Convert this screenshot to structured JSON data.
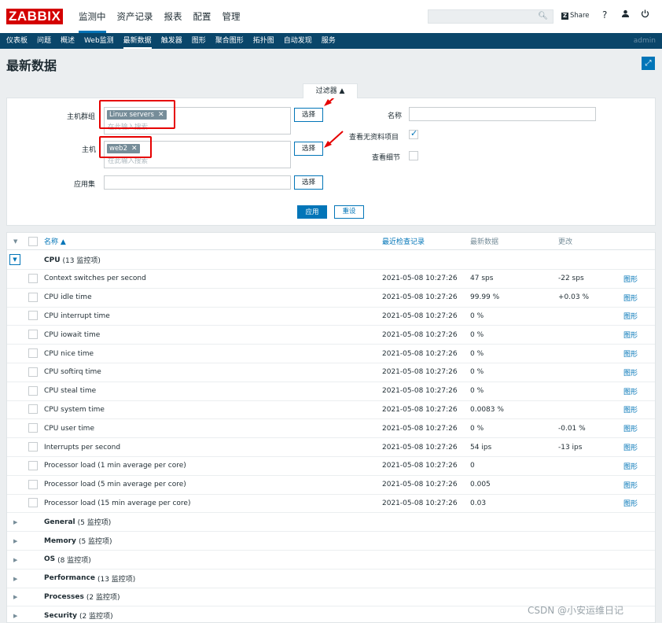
{
  "brand": {
    "logo": "ZABBIX"
  },
  "top_menu": [
    {
      "label": "监测中",
      "active": true
    },
    {
      "label": "资产记录",
      "active": false
    },
    {
      "label": "报表",
      "active": false
    },
    {
      "label": "配置",
      "active": false
    },
    {
      "label": "管理",
      "active": false
    }
  ],
  "top_right": {
    "share_label": "Share",
    "help_label": "?"
  },
  "sub_nav": [
    {
      "label": "仪表板",
      "active": false
    },
    {
      "label": "问题",
      "active": false
    },
    {
      "label": "概述",
      "active": false
    },
    {
      "label": "Web监测",
      "active": false
    },
    {
      "label": "最新数据",
      "active": true
    },
    {
      "label": "触发器",
      "active": false
    },
    {
      "label": "图形",
      "active": false
    },
    {
      "label": "聚合图形",
      "active": false
    },
    {
      "label": "拓扑图",
      "active": false
    },
    {
      "label": "自动发现",
      "active": false
    },
    {
      "label": "服务",
      "active": false
    }
  ],
  "user": "admin",
  "page_title": "最新数据",
  "filter": {
    "tab_label": "过滤器 ▲",
    "host_group_label": "主机群组",
    "host_group_tag": "Linux servers",
    "host_group_placeholder": "在此输入搜索",
    "host_label": "主机",
    "host_tag": "web2",
    "host_placeholder": "在此输入搜索",
    "app_label": "应用集",
    "app_value": "",
    "select_label": "选择",
    "name_label": "名称",
    "name_value": "",
    "show_no_data_label": "查看无资料项目",
    "show_no_data_checked": true,
    "show_details_label": "查看细节",
    "show_details_checked": false,
    "apply_label": "应用",
    "reset_label": "重设"
  },
  "table": {
    "headers": {
      "name": "名称 ▲",
      "last_check": "最近检查记录",
      "last_value": "最新数据",
      "change": "更改"
    },
    "expanded_group": {
      "name": "CPU",
      "count": "(13 监控项)"
    },
    "graph_label": "图形",
    "items": [
      {
        "name": "Context switches per second",
        "last_check": "2021-05-08 10:27:26",
        "last_value": "47 sps",
        "change": "-22 sps"
      },
      {
        "name": "CPU idle time",
        "last_check": "2021-05-08 10:27:26",
        "last_value": "99.99 %",
        "change": "+0.03 %"
      },
      {
        "name": "CPU interrupt time",
        "last_check": "2021-05-08 10:27:26",
        "last_value": "0 %",
        "change": ""
      },
      {
        "name": "CPU iowait time",
        "last_check": "2021-05-08 10:27:26",
        "last_value": "0 %",
        "change": ""
      },
      {
        "name": "CPU nice time",
        "last_check": "2021-05-08 10:27:26",
        "last_value": "0 %",
        "change": ""
      },
      {
        "name": "CPU softirq time",
        "last_check": "2021-05-08 10:27:26",
        "last_value": "0 %",
        "change": ""
      },
      {
        "name": "CPU steal time",
        "last_check": "2021-05-08 10:27:26",
        "last_value": "0 %",
        "change": ""
      },
      {
        "name": "CPU system time",
        "last_check": "2021-05-08 10:27:26",
        "last_value": "0.0083 %",
        "change": ""
      },
      {
        "name": "CPU user time",
        "last_check": "2021-05-08 10:27:26",
        "last_value": "0 %",
        "change": "-0.01 %"
      },
      {
        "name": "Interrupts per second",
        "last_check": "2021-05-08 10:27:26",
        "last_value": "54 ips",
        "change": "-13 ips"
      },
      {
        "name": "Processor load (1 min average per core)",
        "last_check": "2021-05-08 10:27:26",
        "last_value": "0",
        "change": ""
      },
      {
        "name": "Processor load (5 min average per core)",
        "last_check": "2021-05-08 10:27:26",
        "last_value": "0.005",
        "change": ""
      },
      {
        "name": "Processor load (15 min average per core)",
        "last_check": "2021-05-08 10:27:26",
        "last_value": "0.03",
        "change": ""
      }
    ],
    "collapsed_groups": [
      {
        "name": "General",
        "count": "(5 监控项)"
      },
      {
        "name": "Memory",
        "count": "(5 监控项)"
      },
      {
        "name": "OS",
        "count": "(8 监控项)"
      },
      {
        "name": "Performance",
        "count": "(13 监控项)"
      },
      {
        "name": "Processes",
        "count": "(2 监控项)"
      },
      {
        "name": "Security",
        "count": "(2 监控项)"
      }
    ]
  },
  "watermark": "CSDN @小安运维日记",
  "colors": {
    "brand_red": "#d40000",
    "nav_blue": "#0a466a",
    "accent_blue": "#0275b8",
    "annotation_red": "#e60000"
  },
  "icons": [
    "search-icon",
    "share-icon",
    "help-icon",
    "user-icon",
    "power-icon",
    "fullscreen-icon",
    "expand-icon",
    "collapse-icon",
    "remove-tag-icon",
    "red-arrow-annotation"
  ]
}
